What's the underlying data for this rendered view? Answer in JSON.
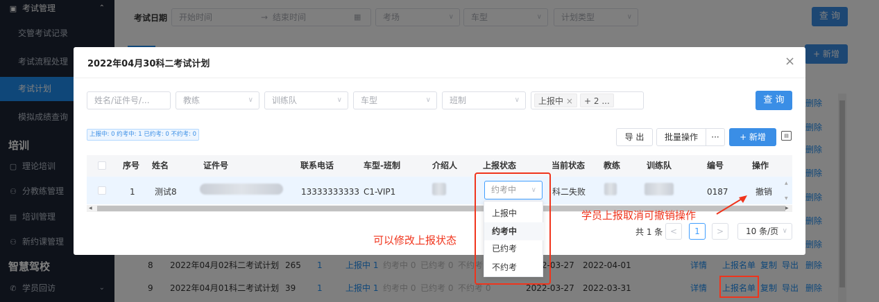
{
  "sidebar": {
    "sections": [
      {
        "title": "考试管理",
        "items": [
          "交管考试记录",
          "考试流程处理",
          "考试计划",
          "模拟成绩查询"
        ]
      },
      {
        "title": "培训",
        "items": [
          "理论培训",
          "分教练管理",
          "培训管理",
          "新约课管理"
        ]
      },
      {
        "title": "智慧驾校",
        "items": [
          "学员回访"
        ]
      }
    ],
    "active_item": "考试计划"
  },
  "background": {
    "filters": {
      "date_label": "考试日期",
      "start_placeholder": "开始时间",
      "arrow": "→",
      "end_placeholder": "结束时间",
      "venue": "考场",
      "car_type": "车型",
      "plan_type": "计划类型"
    },
    "query_label": "查 询",
    "add_label": "+ 新增",
    "delete_label": "删除",
    "rows": [
      {
        "no": "8",
        "name": "2022年04月02科二考试计划",
        "count": "265",
        "n": "1",
        "report": "上报中 1",
        "booking": "约考中 0",
        "booked": "已约考 0",
        "notbooked": "不约考 0",
        "date1": "2022-03-27",
        "date2": "2022-04-01"
      },
      {
        "no": "9",
        "name": "2022年04月01科二考试计划",
        "count": "39",
        "n": "1",
        "report": "上报中 1",
        "booking": "约考中 0",
        "booked": "已约考 0",
        "notbooked": "不约考 0",
        "date1": "2022-03-27",
        "date2": "2022-03-31"
      }
    ],
    "row_actions": {
      "detail": "详情",
      "report_list": "上报名单",
      "copy": "复制",
      "export": "导出",
      "delete": "删除"
    }
  },
  "modal": {
    "title": "2022年04月30科二考试计划",
    "close": "×",
    "filters": {
      "name_id": "姓名/证件号/...",
      "coach": "教练",
      "team": "训练队",
      "car_type": "车型",
      "class": "班制",
      "tag": "上报中",
      "tag_more": "+ 2 ..."
    },
    "query_label": "查 询",
    "stats": "上报中: 0  约考中: 1  已约考: 0  不约考: 0",
    "toolbar": {
      "export": "导 出",
      "batch": "批量操作",
      "more": "···",
      "add": "+ 新增"
    },
    "columns": [
      "序号",
      "姓名",
      "证件号",
      "联系电话",
      "车型-班制",
      "介绍人",
      "上报状态",
      "当前状态",
      "教练",
      "训练队",
      "编号",
      "操作"
    ],
    "row": {
      "no": "1",
      "name": "测试8",
      "phone": "13333333333",
      "car_class": "C1-VIP1",
      "status_select": "约考中",
      "current_status": "科二失败",
      "number": "0187",
      "action": "撤销"
    },
    "dropdown_options": [
      "上报中",
      "约考中",
      "已约考",
      "不约考"
    ],
    "dropdown_selected": "约考中",
    "pagination": {
      "total": "共 1 条",
      "prev": "<",
      "page": "1",
      "next": ">",
      "page_size": "10 条/页"
    }
  },
  "annotations": {
    "modify_status": "可以修改上报状态",
    "cancel_report": "学员上报取消可撤销操作"
  }
}
